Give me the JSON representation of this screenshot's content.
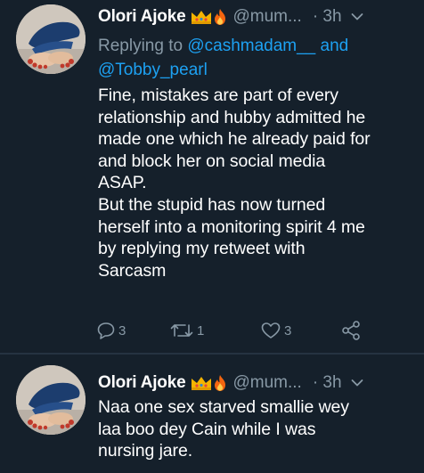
{
  "colors": {
    "background": "#15202b",
    "text": "#ffffff",
    "secondary": "#8899a6",
    "link": "#1da1f2",
    "divider": "#253341"
  },
  "tweets": [
    {
      "author_name": "Olori Ajoke",
      "emojis": [
        "crown-emoji",
        "fire-emoji"
      ],
      "handle": "@mum...",
      "separator": "·",
      "time": "3h",
      "reply_prefix": "Replying to ",
      "reply_mention_1": "@cashmadam__",
      "reply_and": " and",
      "reply_mention_2": "@Tobby_pearl",
      "text": "Fine, mistakes are part of every\nrelationship and hubby admitted  he\nmade one which he already paid for\nand block her on social media\nASAP.\nBut the stupid has now turned\nherself into a monitoring spirit 4 me\nby replying my retweet with\nSarcasm",
      "reply_count": "3",
      "retweet_count": "1",
      "like_count": "3"
    },
    {
      "author_name": "Olori Ajoke",
      "emojis": [
        "crown-emoji",
        "fire-emoji"
      ],
      "handle": "@mum...",
      "separator": "·",
      "time": "3h",
      "text": "Naa one sex starved smallie wey\nlaa  boo dey Cain while I was\nnursing jare."
    }
  ]
}
